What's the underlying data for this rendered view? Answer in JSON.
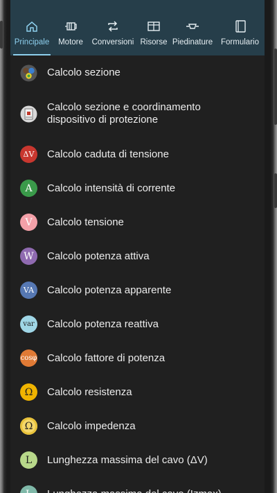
{
  "tabs": [
    {
      "label": "Principale",
      "icon": "home-icon",
      "active": true
    },
    {
      "label": "Motore",
      "icon": "motor-icon",
      "active": false
    },
    {
      "label": "Conversioni",
      "icon": "repeat-icon",
      "active": false
    },
    {
      "label": "Risorse",
      "icon": "book-open-icon",
      "active": false
    },
    {
      "label": "Piedinature",
      "icon": "connector-icon",
      "active": false
    },
    {
      "label": "Formulario",
      "icon": "notebook-icon",
      "active": false
    }
  ],
  "items": [
    {
      "label": "Calcolo sezione",
      "icon": "cable-section-icon",
      "symbol": "",
      "color": "#8a8a8a"
    },
    {
      "label": "Calcolo sezione e coordinamento dispositivo di protezione",
      "icon": "breaker-icon",
      "symbol": "",
      "color": "#d8d8d8"
    },
    {
      "label": "Calcolo caduta di tensione",
      "icon": "voltage-drop-icon",
      "symbol": "ΔV",
      "color": "#c8372f"
    },
    {
      "label": "Calcolo intensità di corrente",
      "icon": "ampere-icon",
      "symbol": "A",
      "color": "#3a9a4a"
    },
    {
      "label": "Calcolo tensione",
      "icon": "volt-icon",
      "symbol": "V",
      "color": "#f3a0a8"
    },
    {
      "label": "Calcolo potenza attiva",
      "icon": "watt-icon",
      "symbol": "W",
      "color": "#8f6ab0"
    },
    {
      "label": "Calcolo potenza apparente",
      "icon": "va-icon",
      "symbol": "VA",
      "color": "#5678b3"
    },
    {
      "label": "Calcolo potenza reattiva",
      "icon": "var-icon",
      "symbol": "var",
      "color": "#9fd6e6"
    },
    {
      "label": "Calcolo fattore di potenza",
      "icon": "cosphi-icon",
      "symbol": "cosφ",
      "color": "#e07a35"
    },
    {
      "label": "Calcolo resistenza",
      "icon": "ohm-icon",
      "symbol": "Ω",
      "color": "#f0b400"
    },
    {
      "label": "Calcolo impedenza",
      "icon": "impedance-icon",
      "symbol": "Ω",
      "color": "#f5d76a"
    },
    {
      "label": "Lunghezza massima del cavo (ΔV)",
      "icon": "cable-length-icon",
      "symbol": "L",
      "color": "#b8d88a"
    },
    {
      "label": "Lunghezza massima del cavo (Izmax)",
      "icon": "cable-length-izmax-icon",
      "symbol": "L",
      "color": "#7fb8a8"
    }
  ]
}
